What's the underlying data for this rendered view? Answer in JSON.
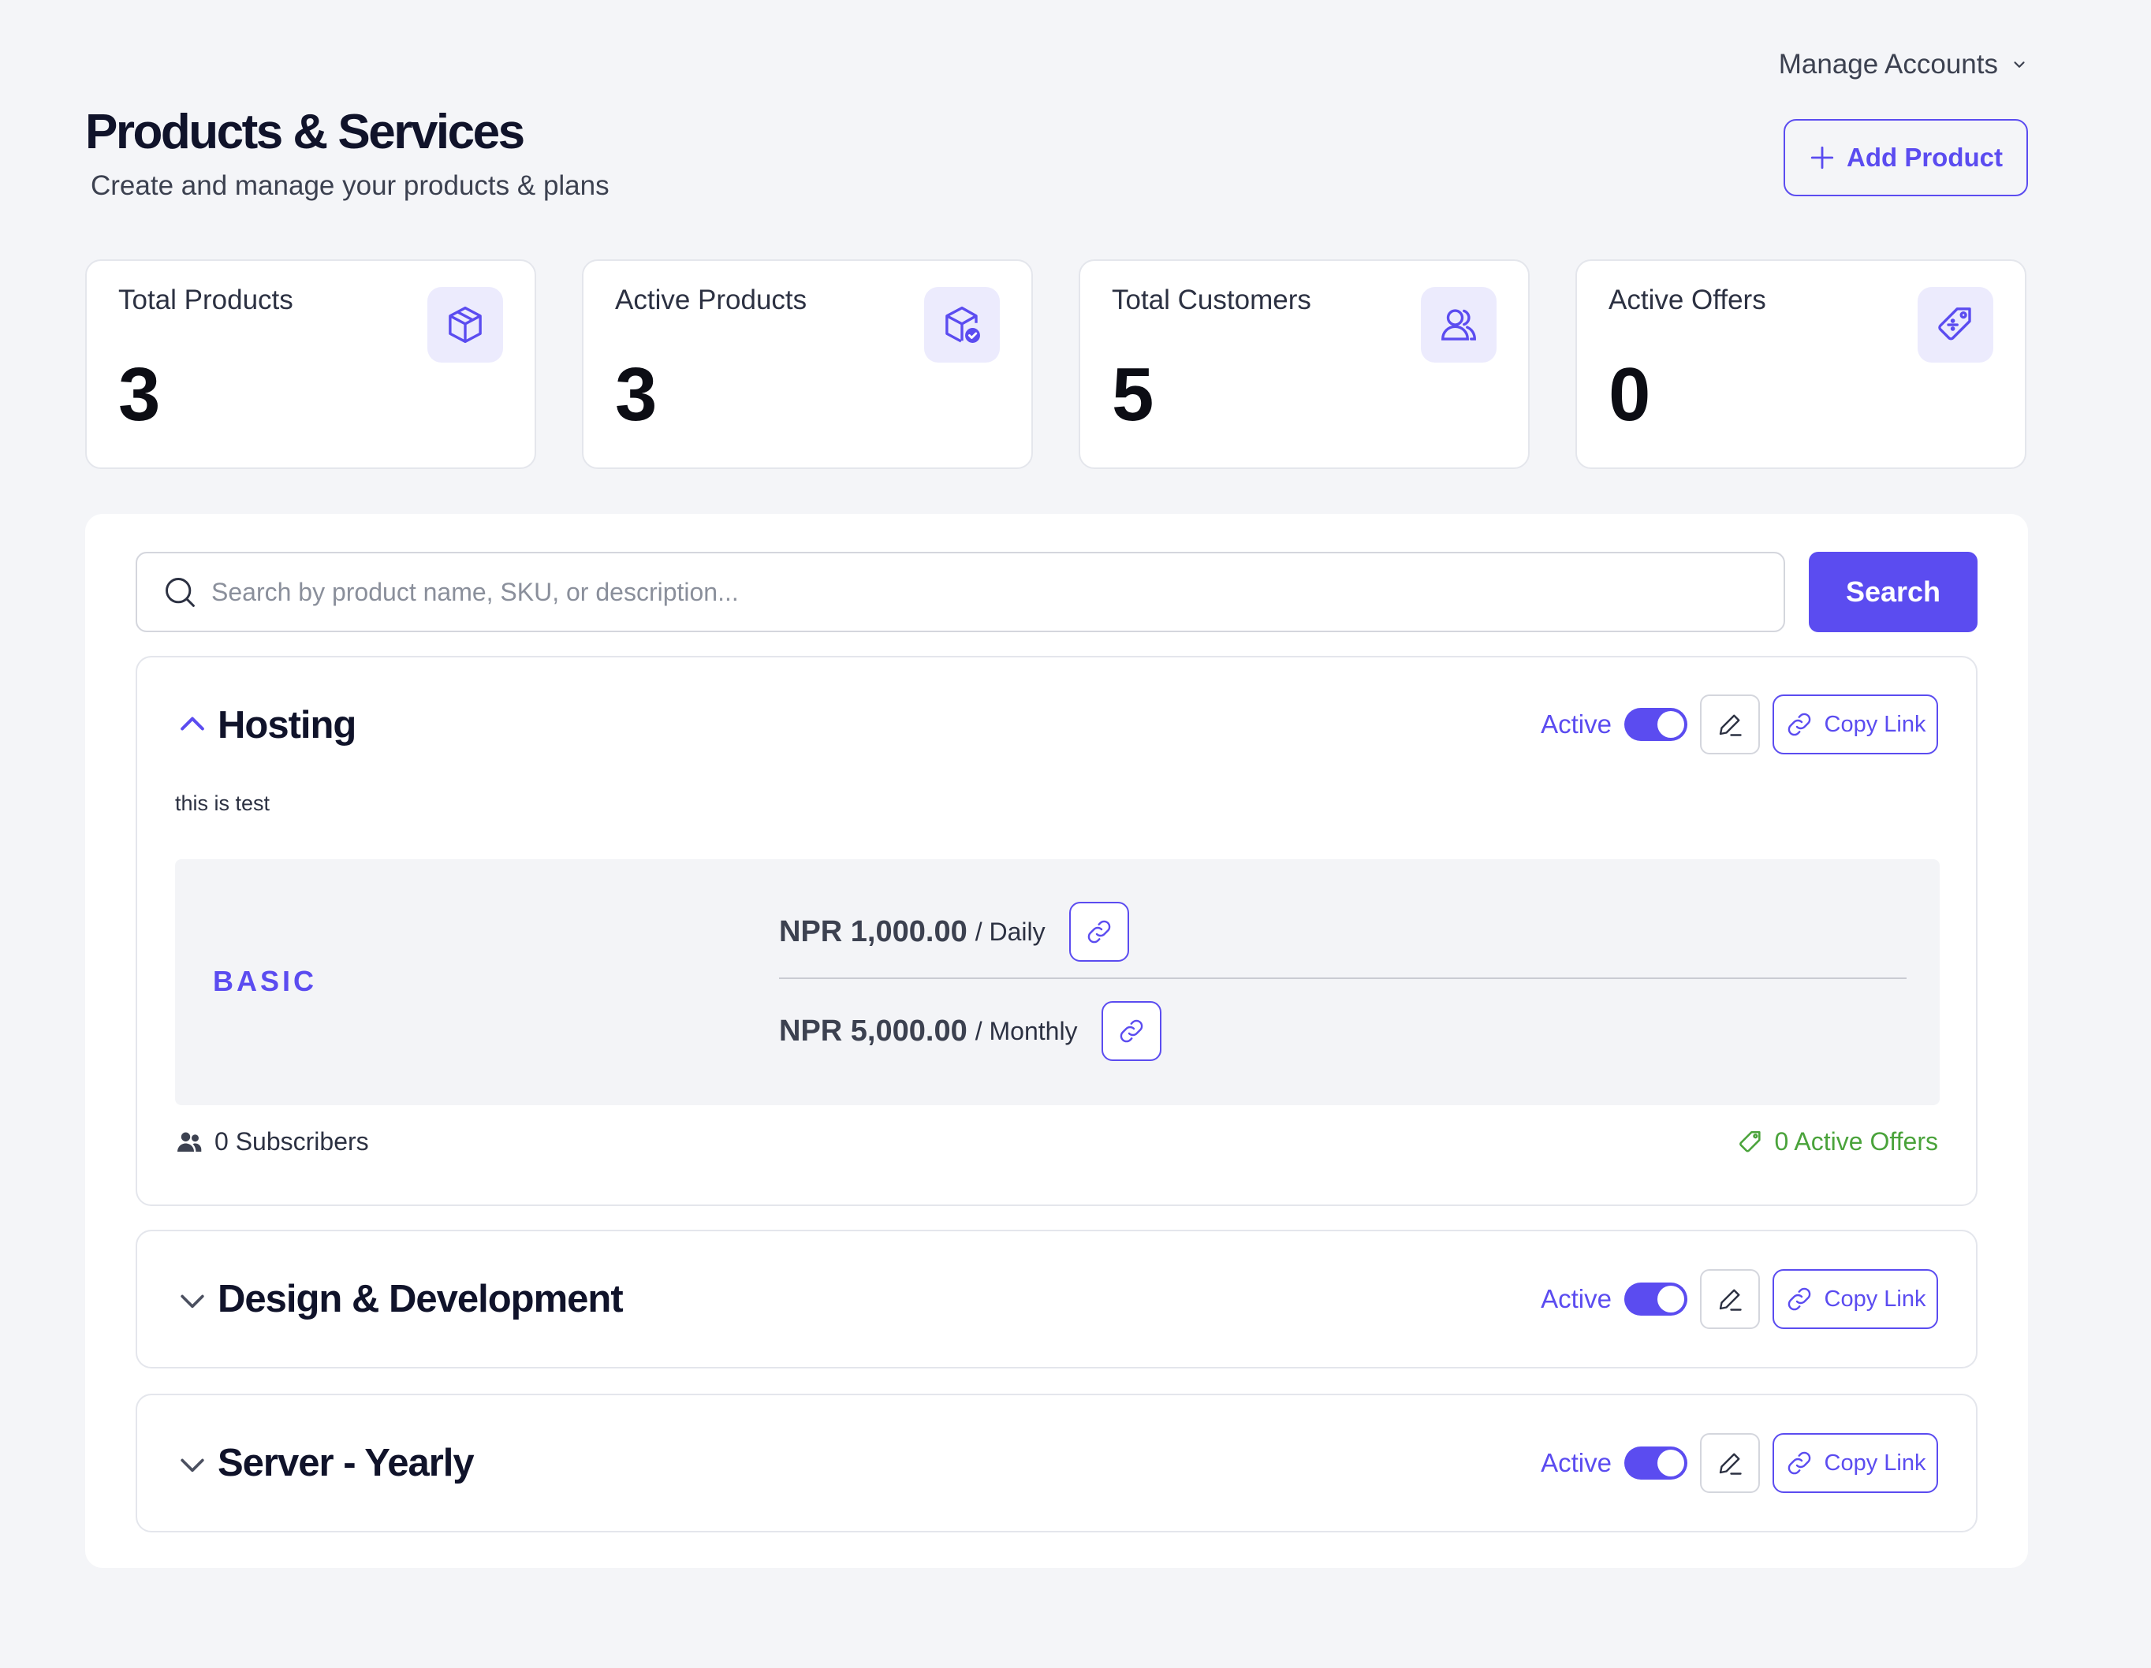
{
  "header": {
    "manage_accounts": "Manage Accounts",
    "title": "Products & Services",
    "subtitle": "Create and manage your products & plans",
    "add_product": "Add Product"
  },
  "stats": [
    {
      "label": "Total Products",
      "value": "3",
      "icon": "box-icon"
    },
    {
      "label": "Active Products",
      "value": "3",
      "icon": "box-check-icon"
    },
    {
      "label": "Total Customers",
      "value": "5",
      "icon": "users-icon"
    },
    {
      "label": "Active Offers",
      "value": "0",
      "icon": "tag-icon"
    }
  ],
  "search": {
    "placeholder": "Search by product name, SKU, or description...",
    "value": "",
    "button": "Search"
  },
  "colors": {
    "accent": "#5b4cf0",
    "success": "#4aa33b",
    "background": "#f4f5f8"
  },
  "products": [
    {
      "name": "Hosting",
      "expanded": true,
      "status_label": "Active",
      "enabled": true,
      "copy_label": "Copy Link",
      "description": "this is test",
      "plan": {
        "name": "BASIC",
        "prices": [
          {
            "amount": "NPR 1,000.00",
            "period": "/ Daily"
          },
          {
            "amount": "NPR 5,000.00",
            "period": "/ Monthly"
          }
        ]
      },
      "subscribers": "0 Subscribers",
      "active_offers": "0 Active Offers"
    },
    {
      "name": "Design & Development",
      "expanded": false,
      "status_label": "Active",
      "enabled": true,
      "copy_label": "Copy Link"
    },
    {
      "name": "Server - Yearly",
      "expanded": false,
      "status_label": "Active",
      "enabled": true,
      "copy_label": "Copy Link"
    }
  ]
}
